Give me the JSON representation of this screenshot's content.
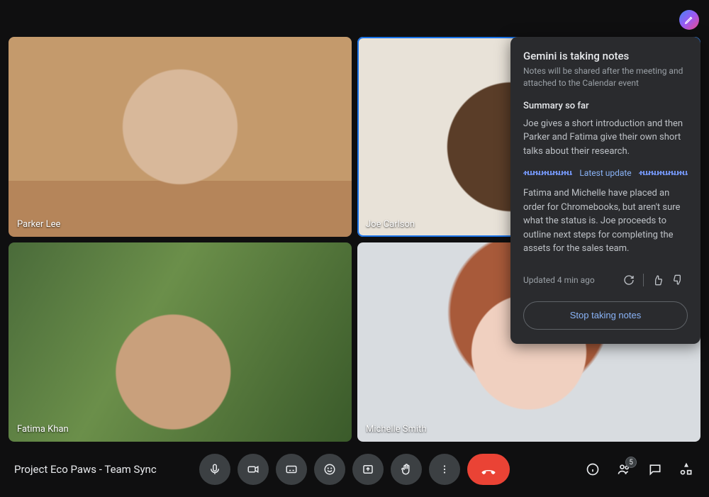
{
  "meeting": {
    "title": "Project Eco Paws - Team Sync"
  },
  "participants": [
    {
      "name": "Parker Lee",
      "active": false
    },
    {
      "name": "Joe Carlson",
      "active": true
    },
    {
      "name": "Fatima Khan",
      "active": false
    },
    {
      "name": "Michelle Smith",
      "active": false
    }
  ],
  "people_count": "5",
  "gemini": {
    "title": "Gemini is taking notes",
    "subtitle": "Notes will be shared after the meeting and attached to the Calendar event",
    "summary_heading": "Summary so far",
    "summary_body": "Joe gives a short introduction and then Parker and Fatima give their own short talks about their research.",
    "latest_label": "Latest update",
    "latest_body": "Fatima and Michelle have placed an order for Chromebooks, but aren't sure what the status is. Joe proceeds to outline next steps for completing the assets for the sales team.",
    "updated_text": "Updated 4 min ago",
    "stop_label": "Stop taking notes"
  }
}
